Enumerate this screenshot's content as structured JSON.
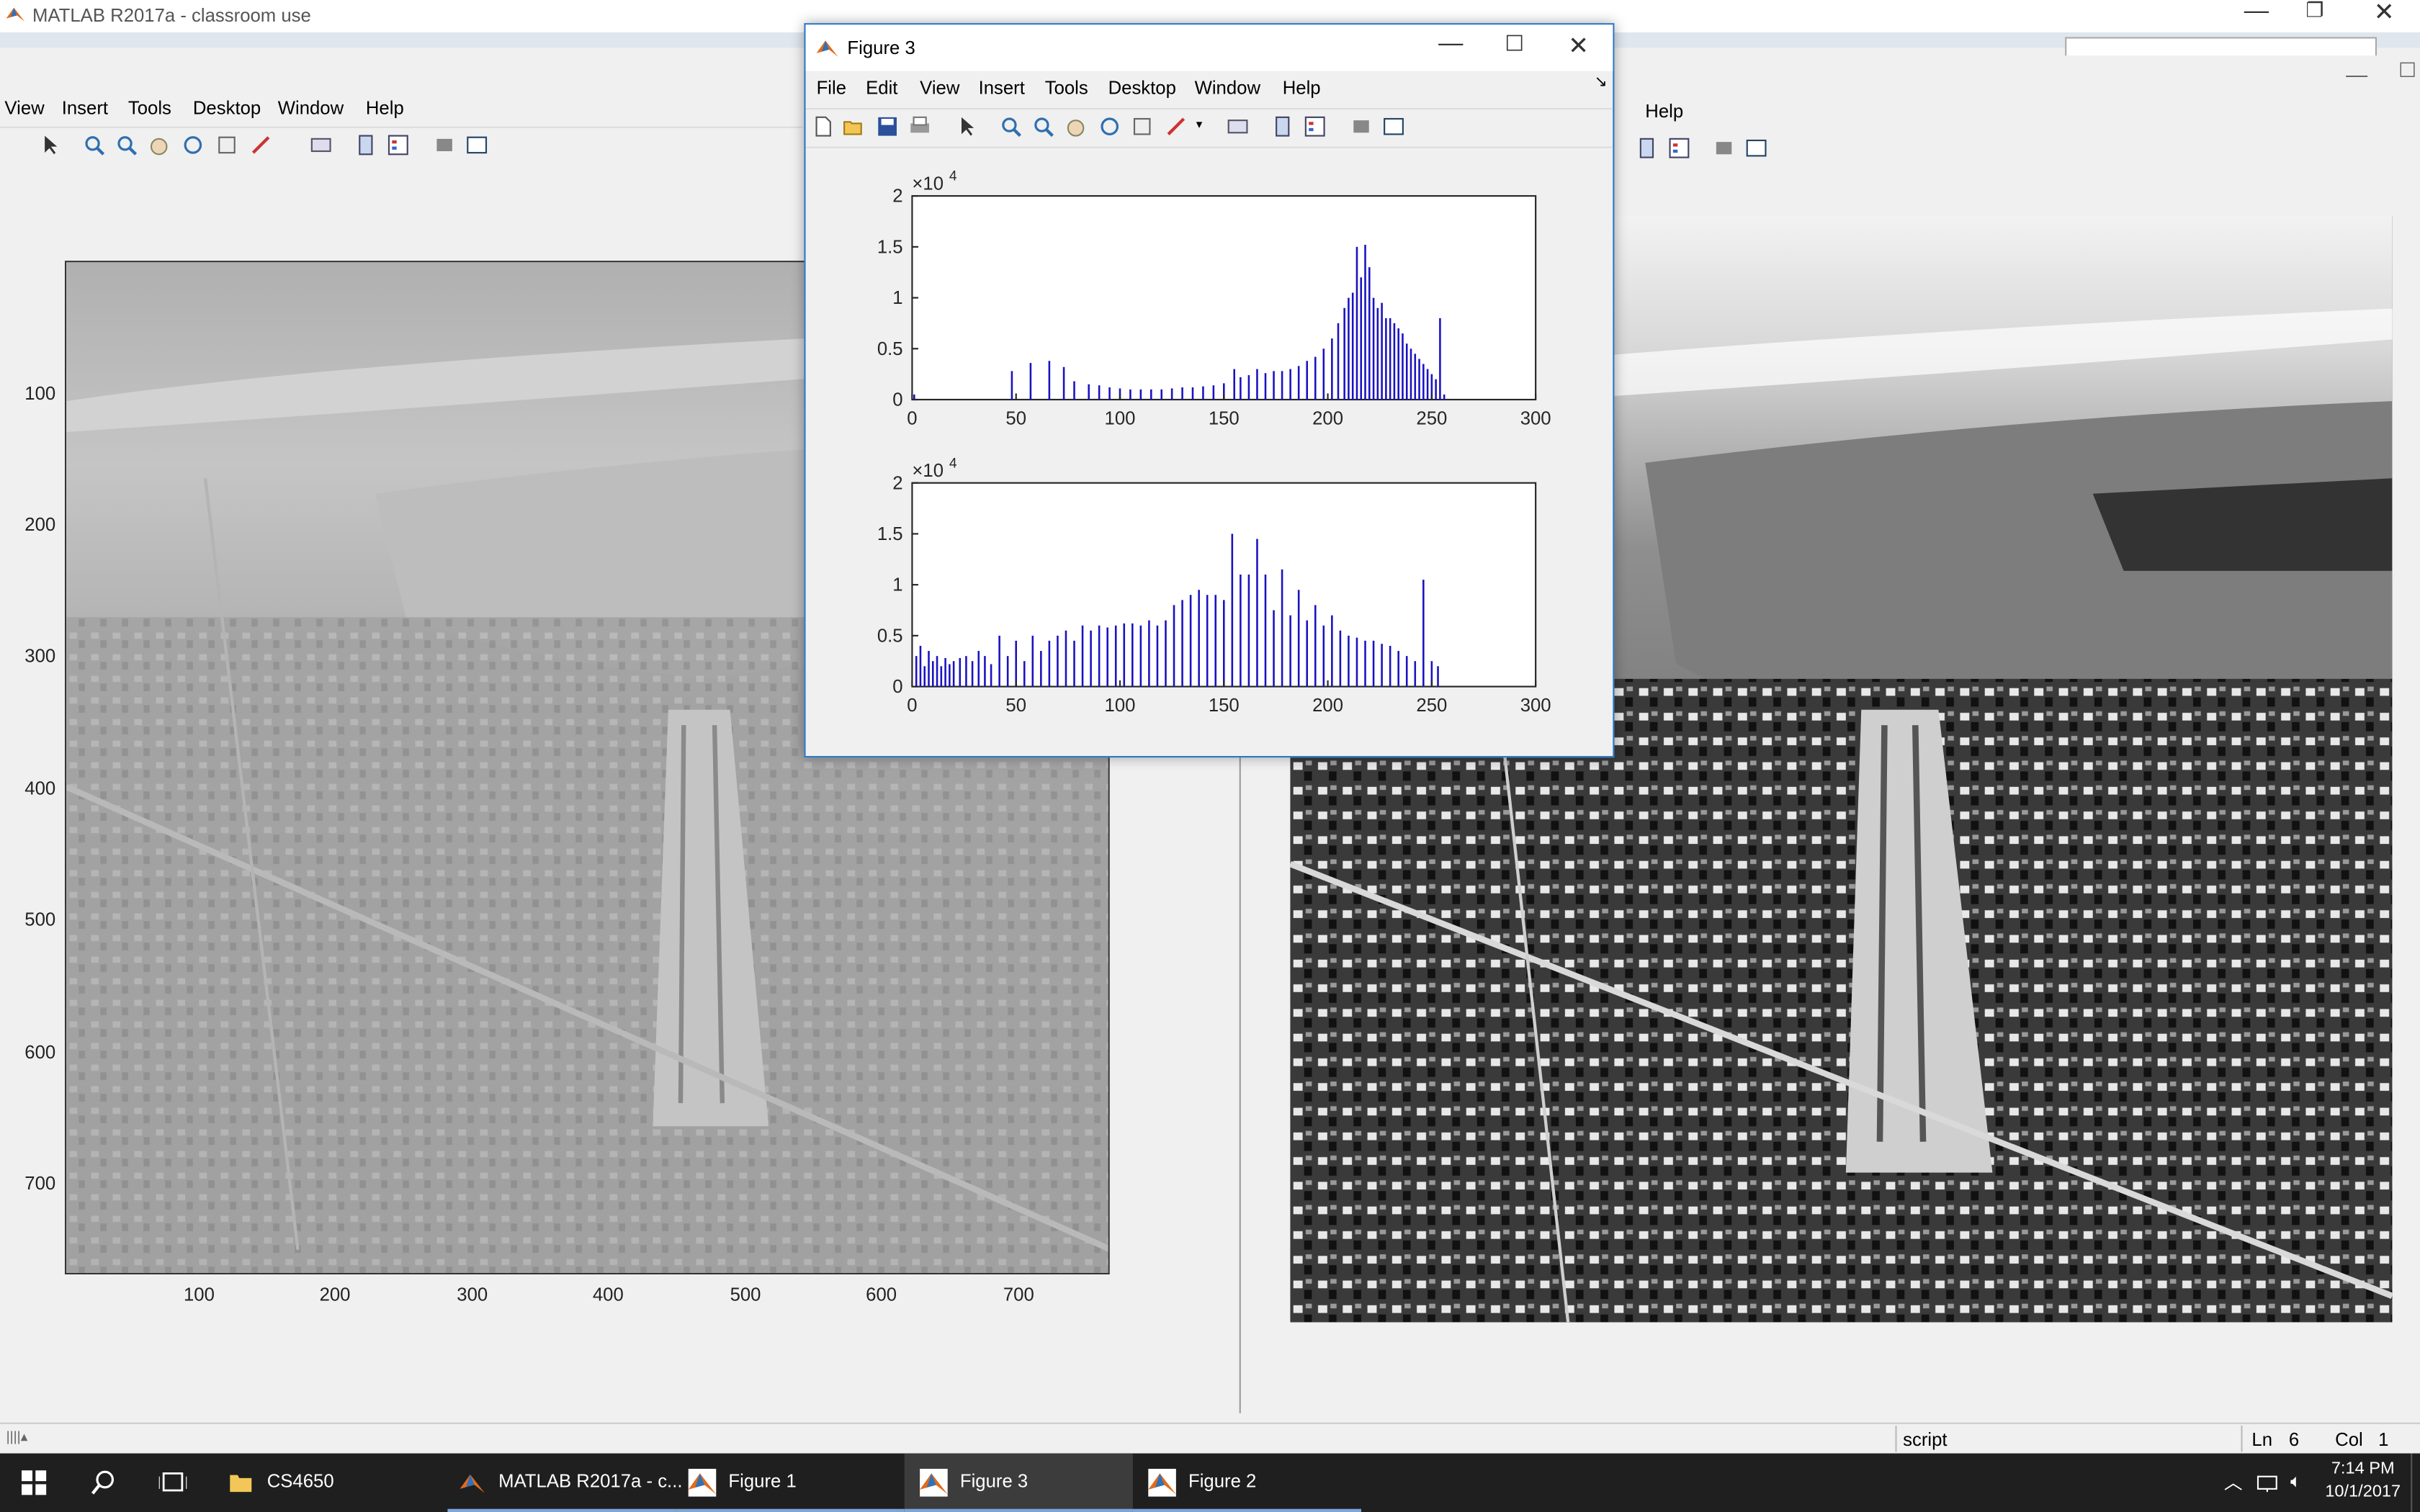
{
  "main_window": {
    "title": "MATLAB R2017a - classroom use",
    "menus": [
      "View",
      "Insert",
      "Tools",
      "Desktop",
      "Window",
      "Help"
    ],
    "right_menu_help": "Help"
  },
  "figure1": {
    "y_ticks": [
      "100",
      "200",
      "300",
      "400",
      "500",
      "600",
      "700"
    ],
    "x_ticks": [
      "100",
      "200",
      "300",
      "400",
      "500",
      "600",
      "700"
    ]
  },
  "figure3": {
    "title": "Figure 3",
    "menus": [
      "File",
      "Edit",
      "View",
      "Insert",
      "Tools",
      "Desktop",
      "Window",
      "Help"
    ]
  },
  "chart_data": [
    {
      "type": "bar",
      "y_exponent_label": "×10",
      "y_exponent_power": "4",
      "x_ticks": [
        "0",
        "50",
        "100",
        "150",
        "200",
        "250",
        "300"
      ],
      "y_ticks": [
        "0",
        "0.5",
        "1",
        "1.5",
        "2"
      ],
      "xlim": [
        0,
        300
      ],
      "ylim": [
        0,
        2
      ],
      "color": "#1a12c0",
      "x": [
        1,
        48,
        57,
        66,
        73,
        78,
        85,
        90,
        95,
        100,
        105,
        110,
        115,
        120,
        125,
        130,
        135,
        140,
        145,
        150,
        155,
        158,
        162,
        166,
        170,
        174,
        178,
        182,
        186,
        190,
        194,
        198,
        202,
        205,
        208,
        210,
        212,
        214,
        216,
        218,
        220,
        222,
        224,
        226,
        228,
        230,
        232,
        234,
        236,
        238,
        240,
        242,
        244,
        246,
        248,
        250,
        252,
        254,
        256
      ],
      "values": [
        0.05,
        0.28,
        0.36,
        0.38,
        0.32,
        0.18,
        0.15,
        0.14,
        0.12,
        0.11,
        0.1,
        0.1,
        0.1,
        0.1,
        0.11,
        0.12,
        0.12,
        0.13,
        0.14,
        0.16,
        0.3,
        0.22,
        0.24,
        0.3,
        0.26,
        0.28,
        0.28,
        0.3,
        0.33,
        0.38,
        0.42,
        0.5,
        0.6,
        0.75,
        0.9,
        1.0,
        1.05,
        1.5,
        1.2,
        1.52,
        1.3,
        1.0,
        0.9,
        0.95,
        0.8,
        0.8,
        0.75,
        0.7,
        0.65,
        0.55,
        0.5,
        0.45,
        0.4,
        0.35,
        0.3,
        0.25,
        0.2,
        0.8,
        0.05
      ]
    },
    {
      "type": "bar",
      "y_exponent_label": "×10",
      "y_exponent_power": "4",
      "x_ticks": [
        "0",
        "50",
        "100",
        "150",
        "200",
        "250",
        "300"
      ],
      "y_ticks": [
        "0",
        "0.5",
        "1",
        "1.5",
        "2"
      ],
      "xlim": [
        0,
        300
      ],
      "ylim": [
        0,
        2
      ],
      "color": "#1a12c0",
      "x": [
        2,
        4,
        6,
        8,
        10,
        12,
        14,
        16,
        18,
        20,
        23,
        26,
        29,
        32,
        35,
        38,
        42,
        46,
        50,
        54,
        58,
        62,
        66,
        70,
        74,
        78,
        82,
        86,
        90,
        94,
        98,
        102,
        106,
        110,
        114,
        118,
        122,
        126,
        130,
        134,
        138,
        142,
        146,
        150,
        154,
        158,
        162,
        166,
        170,
        174,
        178,
        182,
        186,
        190,
        194,
        198,
        202,
        206,
        210,
        214,
        218,
        222,
        226,
        230,
        234,
        238,
        242,
        246,
        250,
        253
      ],
      "values": [
        0.3,
        0.4,
        0.2,
        0.35,
        0.25,
        0.3,
        0.2,
        0.28,
        0.22,
        0.25,
        0.28,
        0.3,
        0.25,
        0.35,
        0.3,
        0.22,
        0.5,
        0.3,
        0.45,
        0.25,
        0.5,
        0.35,
        0.45,
        0.5,
        0.55,
        0.45,
        0.6,
        0.55,
        0.6,
        0.58,
        0.6,
        0.62,
        0.62,
        0.6,
        0.65,
        0.6,
        0.65,
        0.8,
        0.85,
        0.9,
        0.95,
        0.9,
        0.9,
        0.85,
        1.5,
        1.1,
        1.1,
        1.45,
        1.1,
        0.75,
        1.15,
        0.7,
        0.95,
        0.65,
        0.8,
        0.6,
        0.7,
        0.55,
        0.5,
        0.48,
        0.45,
        0.45,
        0.42,
        0.4,
        0.35,
        0.3,
        0.25,
        1.05,
        0.25,
        0.2
      ]
    }
  ],
  "status": {
    "script": "script",
    "ln_label": "Ln",
    "ln_value": "6",
    "col_label": "Col",
    "col_value": "1"
  },
  "taskbar": {
    "items": [
      "CS4650",
      "MATLAB R2017a - c...",
      "Figure 1",
      "Figure 3",
      "Figure 2"
    ],
    "time": "7:14 PM",
    "date": "10/1/2017"
  }
}
